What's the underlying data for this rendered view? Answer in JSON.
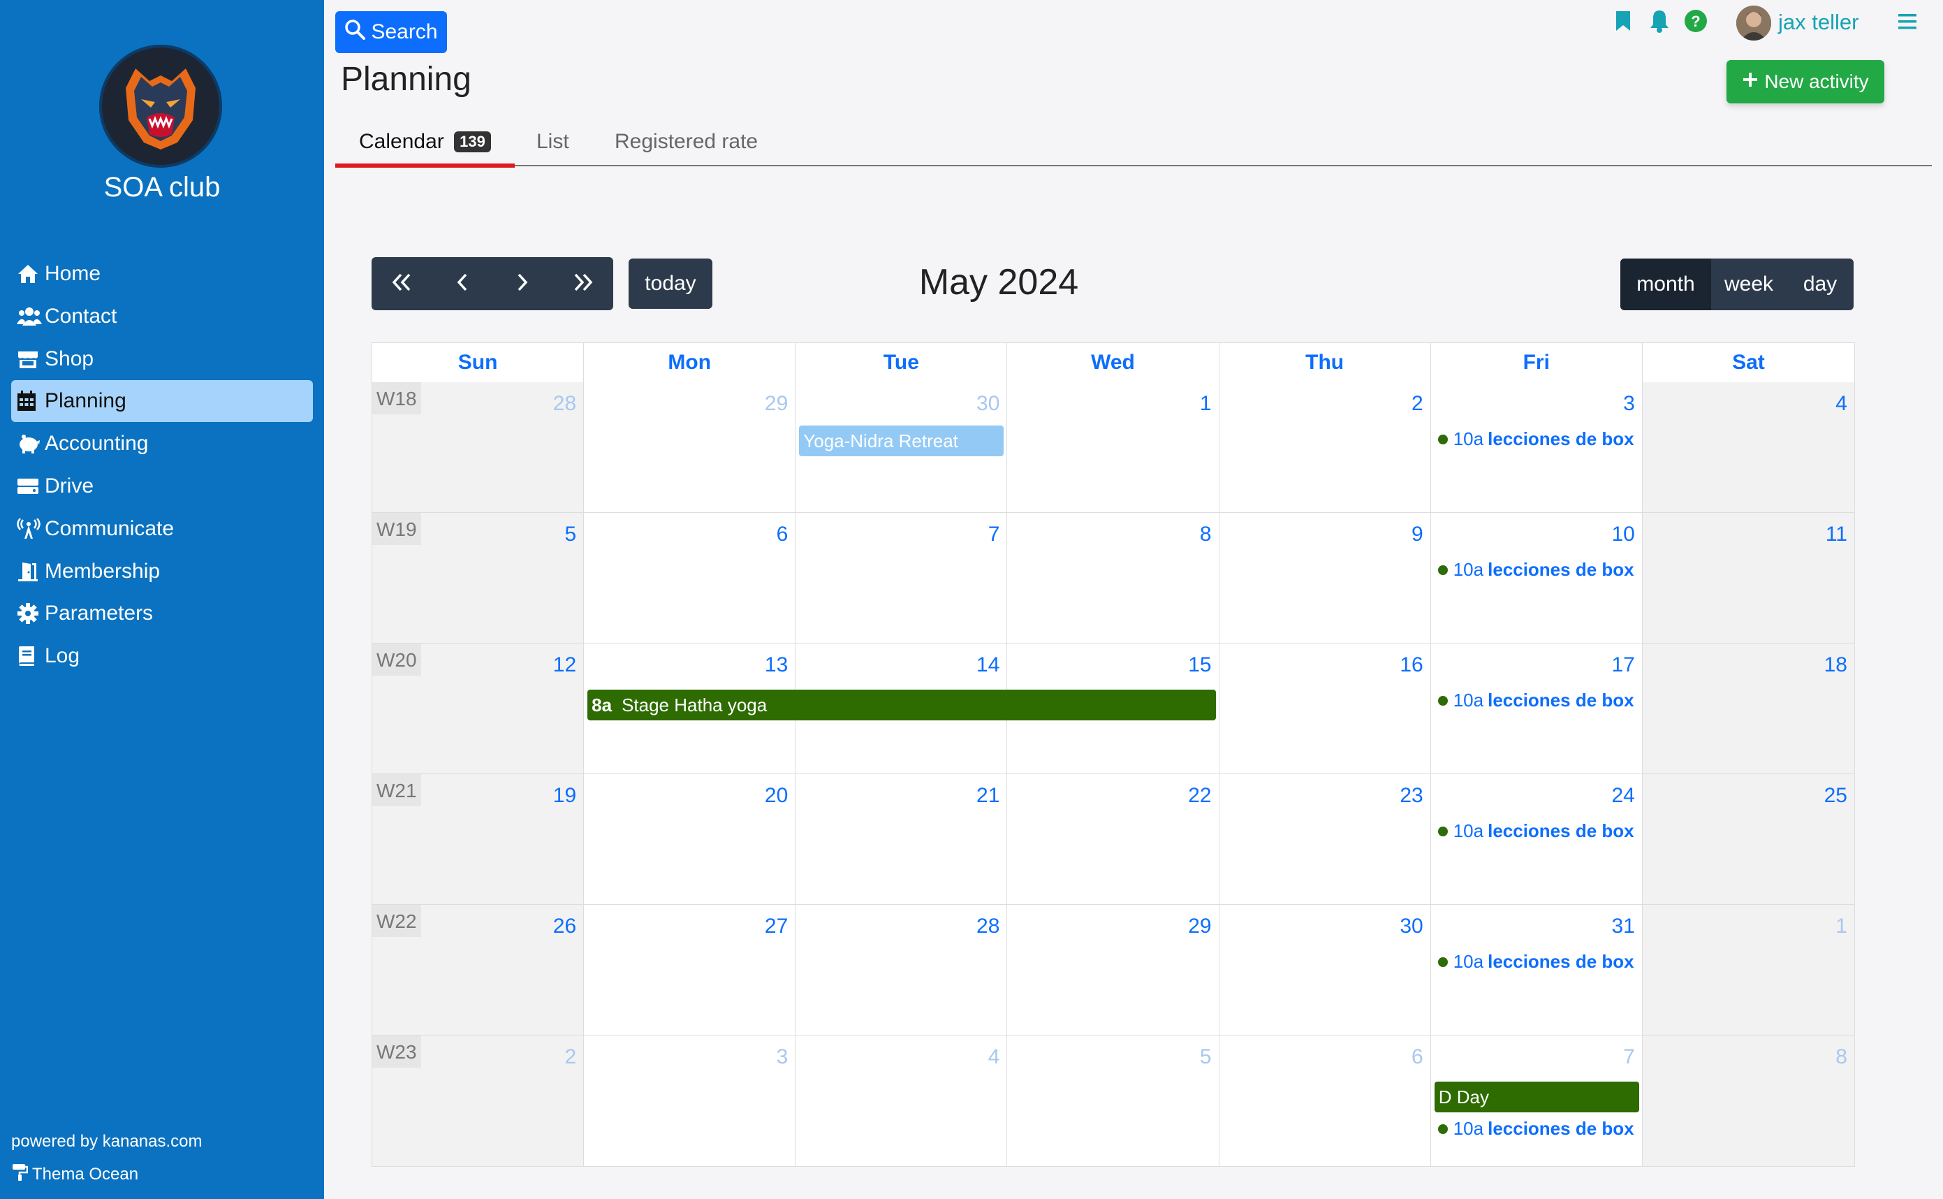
{
  "sidebar": {
    "club_name": "SOA club",
    "items": [
      {
        "label": "Home",
        "icon": "home-icon"
      },
      {
        "label": "Contact",
        "icon": "users-icon"
      },
      {
        "label": "Shop",
        "icon": "store-icon"
      },
      {
        "label": "Planning",
        "icon": "calendar-icon",
        "active": true
      },
      {
        "label": "Accounting",
        "icon": "piggy-bank-icon"
      },
      {
        "label": "Drive",
        "icon": "hard-drive-icon"
      },
      {
        "label": "Communicate",
        "icon": "broadcast-icon"
      },
      {
        "label": "Membership",
        "icon": "door-icon"
      },
      {
        "label": "Parameters",
        "icon": "gear-icon"
      },
      {
        "label": "Log",
        "icon": "book-icon"
      }
    ],
    "powered_by": "powered by kananas.com",
    "theme": "Thema Ocean"
  },
  "header": {
    "search_label": "Search",
    "page_title": "Planning",
    "username": "jax teller",
    "new_activity_label": "New activity"
  },
  "tabs": [
    {
      "label": "Calendar",
      "badge": "139",
      "active": true
    },
    {
      "label": "List"
    },
    {
      "label": "Registered rate"
    }
  ],
  "calendar": {
    "title": "May 2024",
    "today_label": "today",
    "views": [
      {
        "label": "month",
        "active": true
      },
      {
        "label": "week"
      },
      {
        "label": "day"
      }
    ],
    "weekdays": [
      "Sun",
      "Mon",
      "Tue",
      "Wed",
      "Thu",
      "Fri",
      "Sat"
    ],
    "weeks": [
      {
        "label": "W18",
        "days": [
          [
            "28",
            true
          ],
          [
            "29",
            true
          ],
          [
            "30",
            true
          ],
          [
            "1",
            false
          ],
          [
            "2",
            false
          ],
          [
            "3",
            false
          ],
          [
            "4",
            false
          ]
        ]
      },
      {
        "label": "W19",
        "days": [
          [
            "5",
            false
          ],
          [
            "6",
            false
          ],
          [
            "7",
            false
          ],
          [
            "8",
            false
          ],
          [
            "9",
            false
          ],
          [
            "10",
            false
          ],
          [
            "11",
            false
          ]
        ]
      },
      {
        "label": "W20",
        "days": [
          [
            "12",
            false
          ],
          [
            "13",
            false
          ],
          [
            "14",
            false
          ],
          [
            "15",
            false
          ],
          [
            "16",
            false
          ],
          [
            "17",
            false
          ],
          [
            "18",
            false
          ]
        ]
      },
      {
        "label": "W21",
        "days": [
          [
            "19",
            false
          ],
          [
            "20",
            false
          ],
          [
            "21",
            false
          ],
          [
            "22",
            false
          ],
          [
            "23",
            false
          ],
          [
            "24",
            false
          ],
          [
            "25",
            false
          ]
        ]
      },
      {
        "label": "W22",
        "days": [
          [
            "26",
            false
          ],
          [
            "27",
            false
          ],
          [
            "28",
            false
          ],
          [
            "29",
            false
          ],
          [
            "30",
            false
          ],
          [
            "31",
            false
          ],
          [
            "1",
            true
          ]
        ]
      },
      {
        "label": "W23",
        "days": [
          [
            "2",
            true
          ],
          [
            "3",
            true
          ],
          [
            "4",
            true
          ],
          [
            "5",
            true
          ],
          [
            "6",
            true
          ],
          [
            "7",
            true
          ],
          [
            "8",
            true
          ]
        ]
      }
    ],
    "events": {
      "yoga_nidra": "Yoga-Nidra Retreat",
      "hatha_time": "8a",
      "hatha_title": "Stage Hatha yoga",
      "dday": "D Day",
      "box_time": "10a",
      "box_title": "lecciones de box"
    }
  },
  "colors": {
    "sidebar": "#0a72c0",
    "primary": "#0d6efd",
    "success": "#22a845",
    "event_green": "#2e6b00",
    "event_light": "#93c9f5",
    "tab_active_underline": "#e0191e"
  }
}
